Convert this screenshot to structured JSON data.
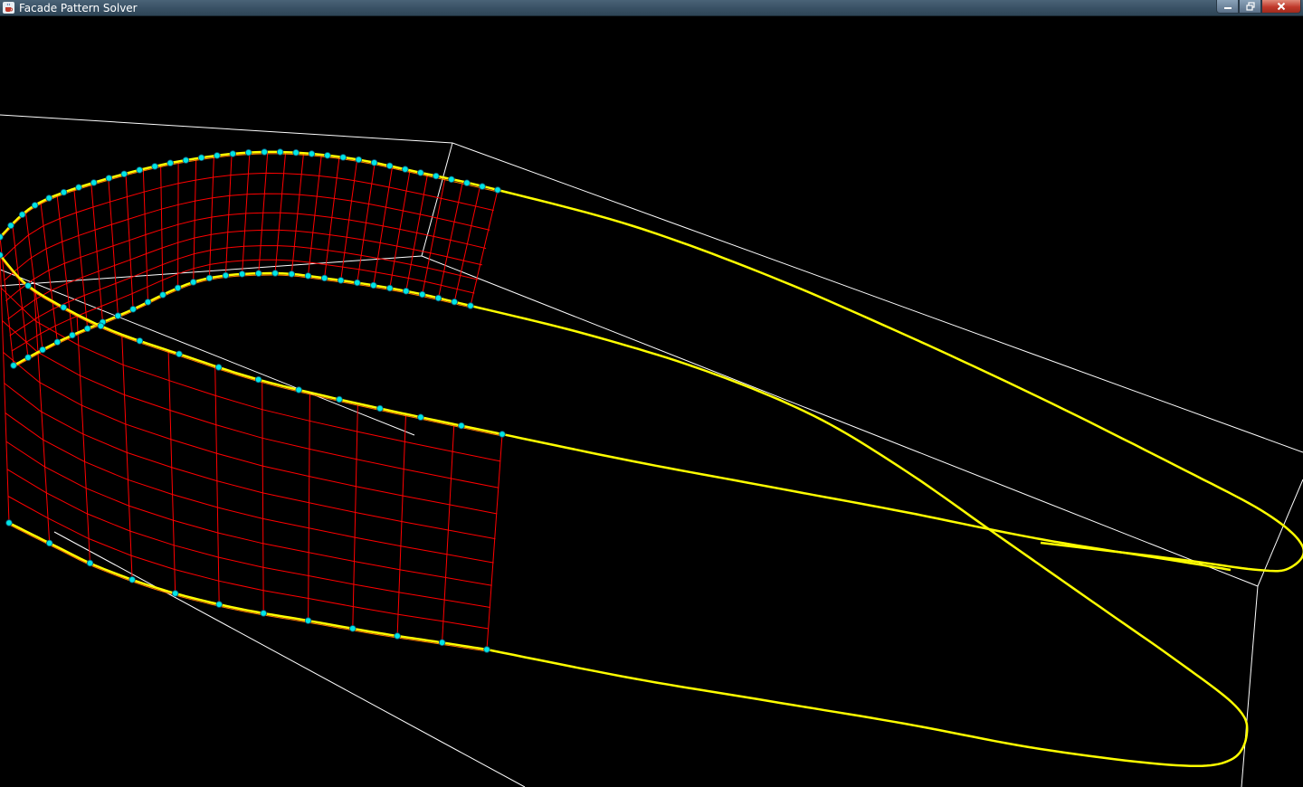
{
  "window": {
    "title": "Facade Pattern Solver",
    "app_icon": "java-coffee-cup-icon",
    "controls": {
      "minimize_icon": "minimize-icon",
      "maximize_icon": "restore-icon",
      "close_icon": "close-icon"
    }
  },
  "viewport": {
    "background": "#000000",
    "colors": {
      "bounding_box": "#ffffff",
      "guide_curve": "#ffff00",
      "mesh_grid": "#ff0000",
      "control_points": "#00e5e5",
      "control_point_outline": "#0a5a7a"
    }
  }
}
